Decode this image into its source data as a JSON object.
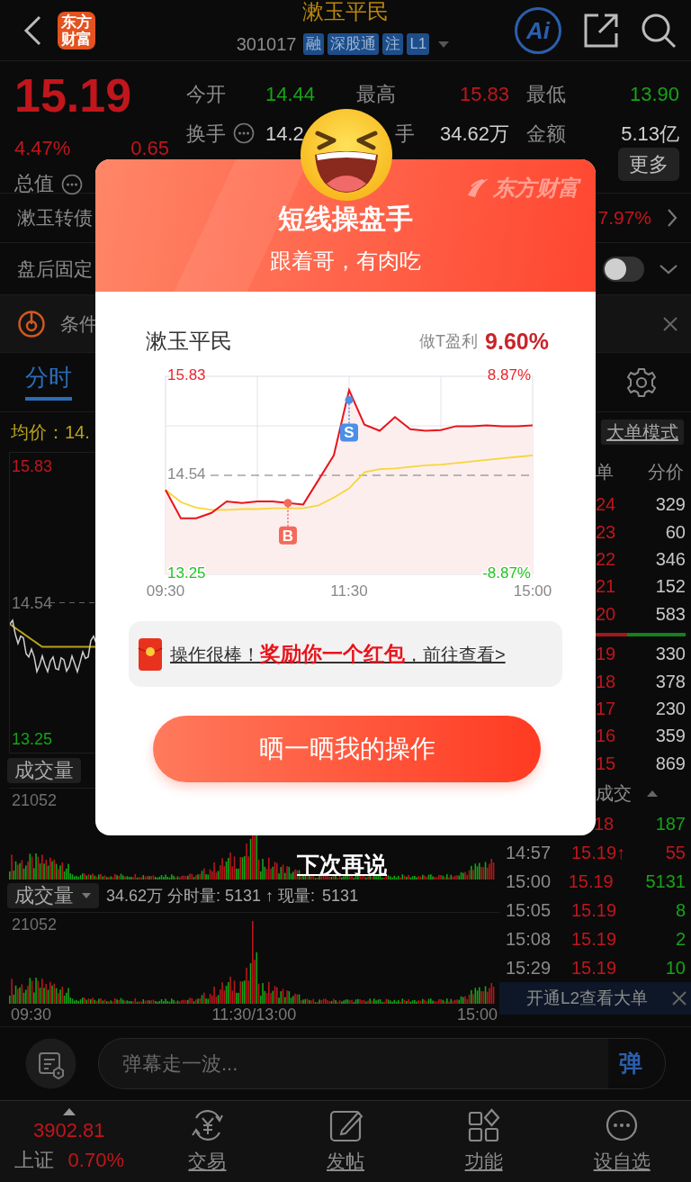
{
  "header": {
    "logo": "东方财富",
    "title": "漱玉平民",
    "code": "301017",
    "tags": [
      "融",
      "深股通",
      "注",
      "L1"
    ],
    "ai_label": "Ai"
  },
  "quote": {
    "price": "15.19",
    "change_pct": "4.47%",
    "change": "0.65",
    "market_cap_label": "总值",
    "stats": [
      [
        {
          "label": "今开",
          "info": false,
          "value": "14.44",
          "color": "#17a317"
        },
        {
          "label": "最高",
          "info": false,
          "value": "15.83",
          "color": "#c0161c"
        },
        {
          "label": "最低",
          "info": false,
          "value": "13.90",
          "color": "#17a317"
        }
      ],
      [
        {
          "label": "换手",
          "info": true,
          "value": "14.2",
          "color": "#cfcfcf"
        },
        {
          "label": "手",
          "info": false,
          "value": "34.62万",
          "color": "#cfcfcf"
        },
        {
          "label": "金额",
          "info": false,
          "value": "5.13亿",
          "color": "#cfcfcf"
        }
      ]
    ],
    "more_button": "更多"
  },
  "info_rows": [
    {
      "kind": "link",
      "label": "漱玉转债",
      "value": "7.97%"
    },
    {
      "kind": "toggle",
      "label": "盘后固定",
      "on": false
    },
    {
      "kind": "alert",
      "label": "条件"
    }
  ],
  "tabs": [
    {
      "label": "分时",
      "selected": true
    }
  ],
  "intraday": {
    "avg_label": "均价：14.",
    "axis": [
      "15.83",
      "14.54",
      "13.25"
    ],
    "volume_label": "成交量",
    "volume_max": "21052",
    "volume_selector": "成交量",
    "volume_summary": "34.62万 分时量: 5131 ↑ 现量:",
    "current_volume": "5131",
    "volume_max_2": "21052",
    "time_labels": [
      "09:30",
      "11:30/13:00",
      "15:00"
    ]
  },
  "order_book": {
    "mode_button": "大单模式",
    "columns": [
      "单",
      "分价"
    ],
    "asks": [
      {
        "price": "24",
        "volume": "329"
      },
      {
        "price": "23",
        "volume": "60"
      },
      {
        "price": "22",
        "volume": "346"
      },
      {
        "price": "21",
        "volume": "152"
      },
      {
        "price": "20",
        "volume": "583"
      }
    ],
    "ratio_bar": {
      "level": 0.68
    },
    "bids": [
      {
        "price": "19",
        "volume": "330"
      },
      {
        "price": "18",
        "volume": "378"
      },
      {
        "price": "17",
        "volume": "230"
      },
      {
        "price": "16",
        "volume": "359"
      },
      {
        "price": "15",
        "volume": "869"
      }
    ]
  },
  "trades": {
    "header": "成交",
    "rows": [
      {
        "price": "18",
        "volume": "187",
        "color": "#17a317"
      },
      {
        "time": "14:57",
        "price": "15.19↑",
        "volume": "55",
        "color": "#c0161c"
      },
      {
        "time": "15:00",
        "price": "15.19",
        "volume": "5131",
        "color": "#17a317"
      },
      {
        "time": "15:05",
        "price": "15.19",
        "volume": "8",
        "color": "#17a317"
      },
      {
        "time": "15:08",
        "price": "15.19",
        "volume": "2",
        "color": "#17a317"
      },
      {
        "time": "15:29",
        "price": "15.19",
        "volume": "10",
        "color": "#17a317"
      }
    ]
  },
  "l2_banner": {
    "text": "开通L2查看大单"
  },
  "comment_bar": {
    "placeholder": "弹幕走一波...",
    "send": "弹"
  },
  "bottom_nav": {
    "index": {
      "value": "3902.81",
      "name": "上证",
      "change": "0.70%"
    },
    "items": [
      {
        "label": "交易",
        "kind": "trade"
      },
      {
        "label": "发帖",
        "kind": "post"
      },
      {
        "label": "功能",
        "kind": "apps"
      },
      {
        "label": "设自选",
        "kind": "more"
      }
    ]
  },
  "modal": {
    "title": "短线操盘手",
    "subtitle": "跟着哥，有肉吃",
    "brand": "东方财富",
    "stock": "漱玉平民",
    "profit_label": "做T盈利",
    "profit": "9.60%",
    "chart_data": {
      "type": "line",
      "categories": [
        "09:30",
        null,
        null,
        null,
        null,
        null,
        null,
        null,
        null,
        null,
        null,
        null,
        "11:30",
        null,
        null,
        null,
        null,
        null,
        null,
        null,
        null,
        null,
        null,
        null,
        "15:00"
      ],
      "series": [
        {
          "type": "area",
          "color": "#e8141c",
          "values": [
            14.35,
            13.98,
            13.98,
            14.05,
            14.2,
            14.18,
            14.2,
            14.2,
            14.18,
            14.16,
            14.48,
            14.8,
            15.65,
            15.2,
            15.12,
            15.3,
            15.14,
            15.12,
            15.13,
            15.18,
            15.18,
            15.19,
            15.18,
            15.18,
            15.19
          ]
        },
        {
          "type": "line",
          "color": "#f5d63a",
          "values": [
            14.35,
            14.19,
            14.12,
            14.09,
            14.09,
            14.1,
            14.1,
            14.11,
            14.11,
            14.11,
            14.15,
            14.25,
            14.37,
            14.58,
            14.62,
            14.63,
            14.65,
            14.67,
            14.68,
            14.7,
            14.72,
            14.74,
            14.76,
            14.78,
            14.8
          ]
        }
      ],
      "ylim": [
        13.25,
        15.83
      ],
      "yticks": [
        {
          "value": 13.25,
          "label": "13.25"
        },
        {
          "value": 14.54,
          "label": "14.54"
        },
        {
          "value": 15.83,
          "label": "15.83"
        }
      ],
      "grid": true,
      "ref_lines": [
        {
          "axis": "y",
          "value": 14.54
        }
      ],
      "annotations": [
        {
          "text": "B",
          "y": 14.18
        },
        {
          "text": "S",
          "x": "11:30",
          "y": 15.52
        }
      ]
    },
    "right_axis": [
      "8.87%",
      "-8.87%"
    ],
    "reward": "操作很棒！**奖励你一个红包**，前往查看>",
    "share_button": "晒一晒我的操作",
    "dismiss": "下次再说"
  }
}
